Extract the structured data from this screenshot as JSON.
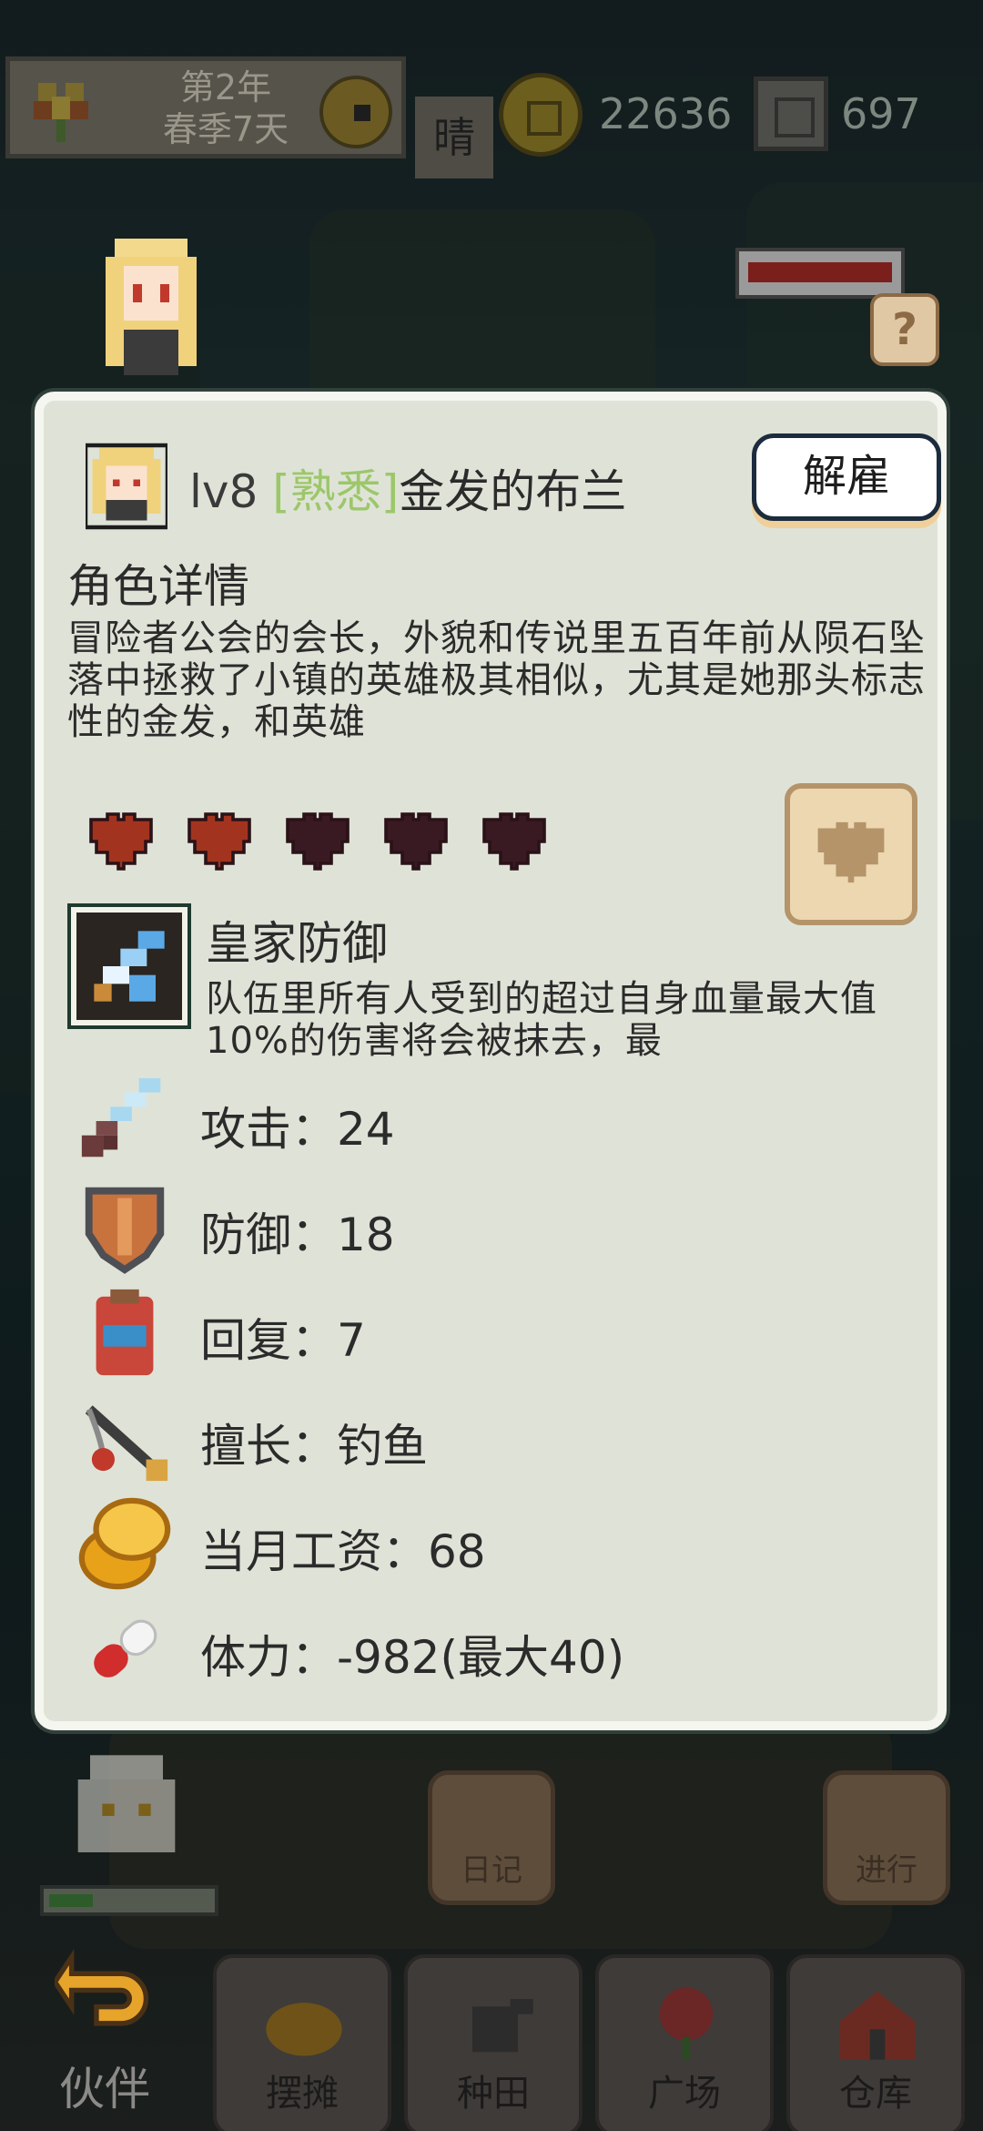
{
  "top_bar": {
    "year": "第2年",
    "season_day": "春季7天",
    "weather": "晴",
    "gold": "22636",
    "gems": "697"
  },
  "panel": {
    "level": "lv8",
    "relation": "[熟悉]",
    "name": "金发的布兰",
    "fire_button": "解雇",
    "section_title": "角色详情",
    "description": "冒险者公会的会长，外貌和传说里五百年前从陨石坠落中拯救了小镇的英雄极其相似，尤其是她那头标志性的金发，和英雄",
    "hearts_filled": 2,
    "hearts_total": 5,
    "skill_name": "皇家防御",
    "skill_description": "队伍里所有人受到的超过自身血量最大值10%的伤害将会被抹去，最",
    "stats": {
      "attack": "攻击：24",
      "defense": "防御：18",
      "recover": "回复：7",
      "specialty": "擅长：钓鱼",
      "salary": "当月工资：68",
      "stamina": "体力：-982(最大40)"
    }
  },
  "lower": {
    "diary_label": "日记",
    "proceed_label": "进行"
  },
  "nav": {
    "partner": "伙伴",
    "stall": "摆摊",
    "farming": "种田",
    "plaza": "广场",
    "warehouse": "仓库"
  },
  "colors": {
    "panel_bg": "#dfe3d7",
    "heart_full": "#a2341f",
    "heart_empty": "#3a1a22",
    "relation": "#9cc76a"
  }
}
